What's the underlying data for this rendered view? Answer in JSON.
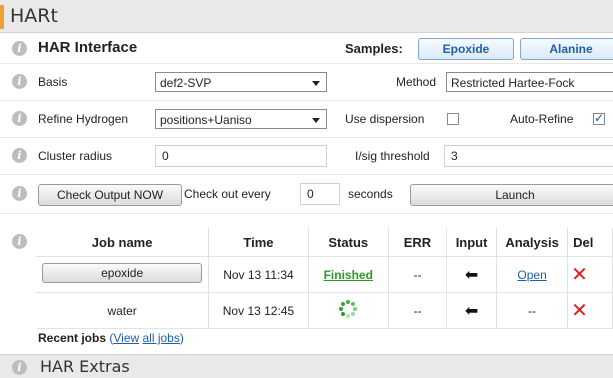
{
  "app": {
    "title": "HARt"
  },
  "interface": {
    "heading": "HAR Interface",
    "samples_label": "Samples:",
    "sample_buttons": [
      "Epoxide",
      "Alanine"
    ]
  },
  "basis": {
    "label": "Basis",
    "value": "def2-SVP"
  },
  "method": {
    "label": "Method",
    "value": "Restricted Hartee-Fock"
  },
  "refine_hydrogen": {
    "label": "Refine Hydrogen",
    "value": "positions+Uaniso"
  },
  "dispersion": {
    "label": "Use dispersion",
    "checked": false
  },
  "auto_refine": {
    "label": "Auto-Refine",
    "checked": true
  },
  "cluster_radius": {
    "label": "Cluster radius",
    "value": "0"
  },
  "isig": {
    "label": "I/sig threshold",
    "value": "3"
  },
  "output": {
    "check_now": "Check Output NOW",
    "check_every": "Check out every",
    "interval": "0",
    "seconds": "seconds",
    "launch": "Launch"
  },
  "jobs": {
    "headers": [
      "Job name",
      "Time",
      "Status",
      "ERR",
      "Input",
      "Analysis",
      "Del"
    ],
    "rows": [
      {
        "name": "epoxide",
        "time": "Nov 13 11:34",
        "status": "Finished",
        "err": "--",
        "analysis": "Open"
      },
      {
        "name": "water",
        "time": "Nov 13 12:45",
        "status": "running-spinner",
        "err": "--",
        "analysis": "--"
      }
    ]
  },
  "recent": {
    "label": "Recent jobs",
    "paren_open": "(",
    "view": "View",
    "all_jobs": "all jobs",
    "paren_close": ")"
  },
  "extras": {
    "title": "HAR Extras"
  },
  "colors": {
    "accent": "#f0a030",
    "link": "#1f5ea8",
    "finished": "#2a9a2a",
    "delete": "#e02020"
  }
}
